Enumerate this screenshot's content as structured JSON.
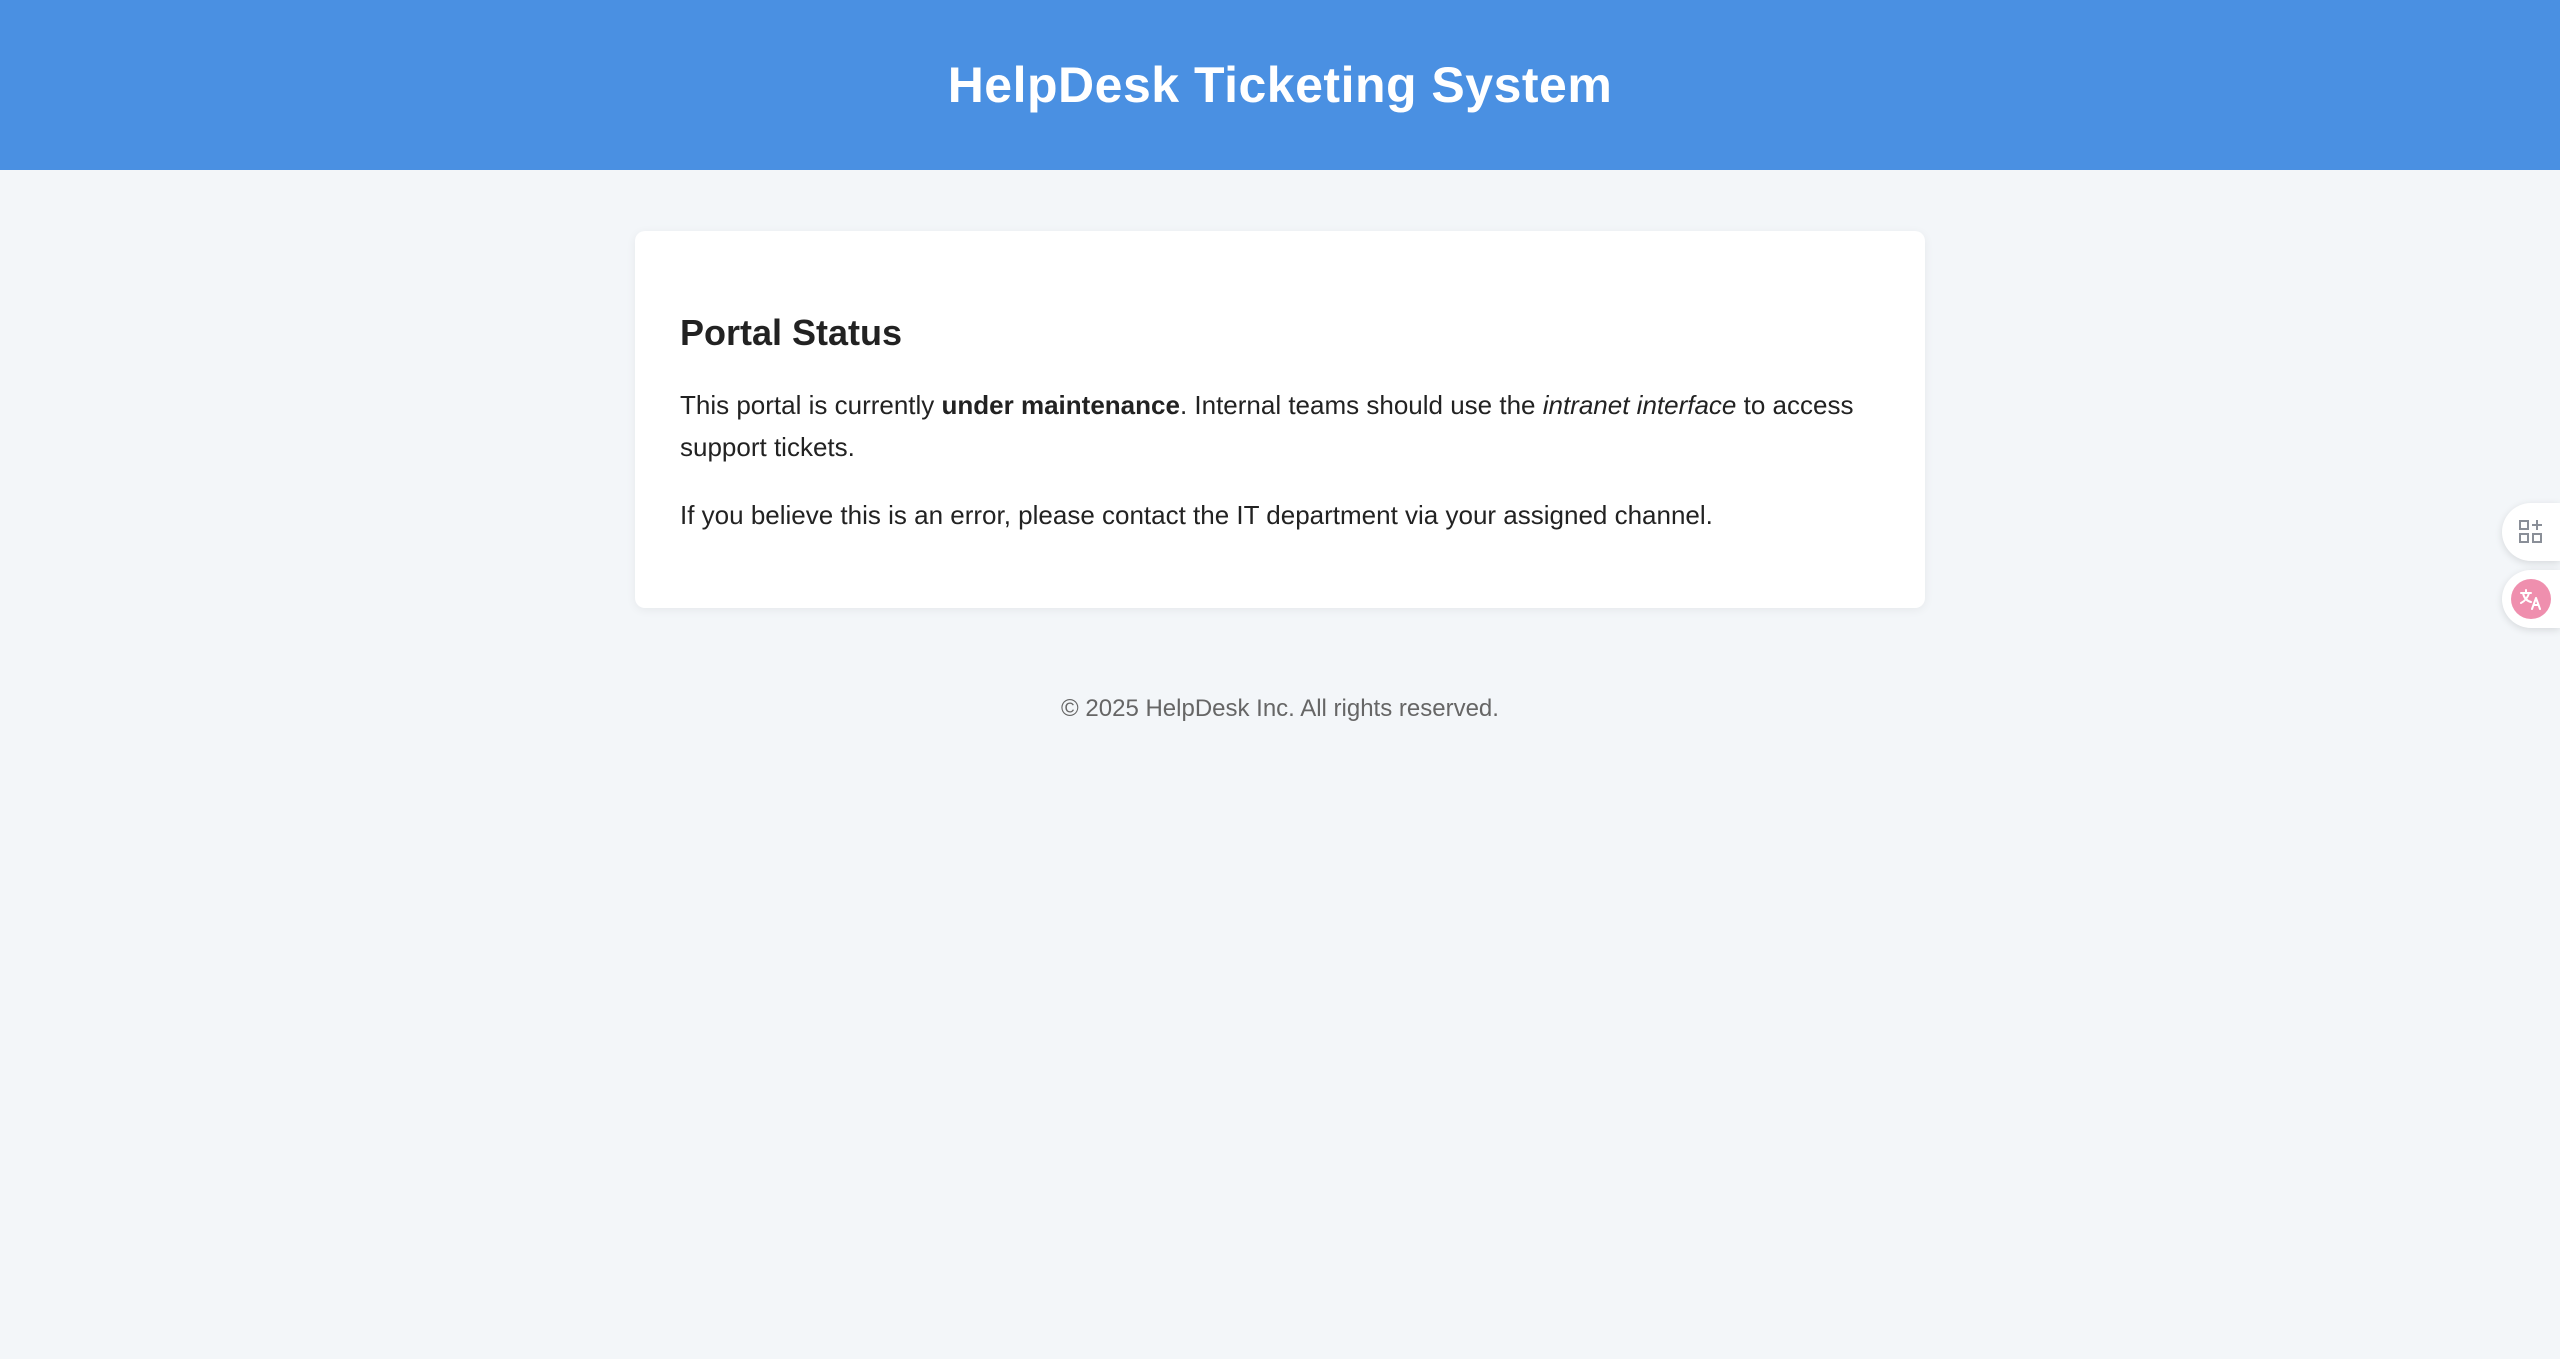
{
  "header": {
    "title": "HelpDesk Ticketing System"
  },
  "card": {
    "title": "Portal Status",
    "para1": {
      "prefix": "This portal is currently ",
      "bold": "under maintenance",
      "middle": ". Internal teams should use the ",
      "italic": "intranet interface",
      "suffix": " to access support tickets."
    },
    "para2": "If you believe this is an error, please contact the IT department via your assigned channel."
  },
  "footer": {
    "text": "© 2025 HelpDesk Inc. All rights reserved."
  },
  "side_widgets": {
    "apps_icon": "grid-plus-icon",
    "translate_icon": "translate-icon"
  },
  "colors": {
    "header_bg": "#4a90e2",
    "page_bg": "#f3f6f9",
    "translate_accent": "#ef8fae"
  }
}
